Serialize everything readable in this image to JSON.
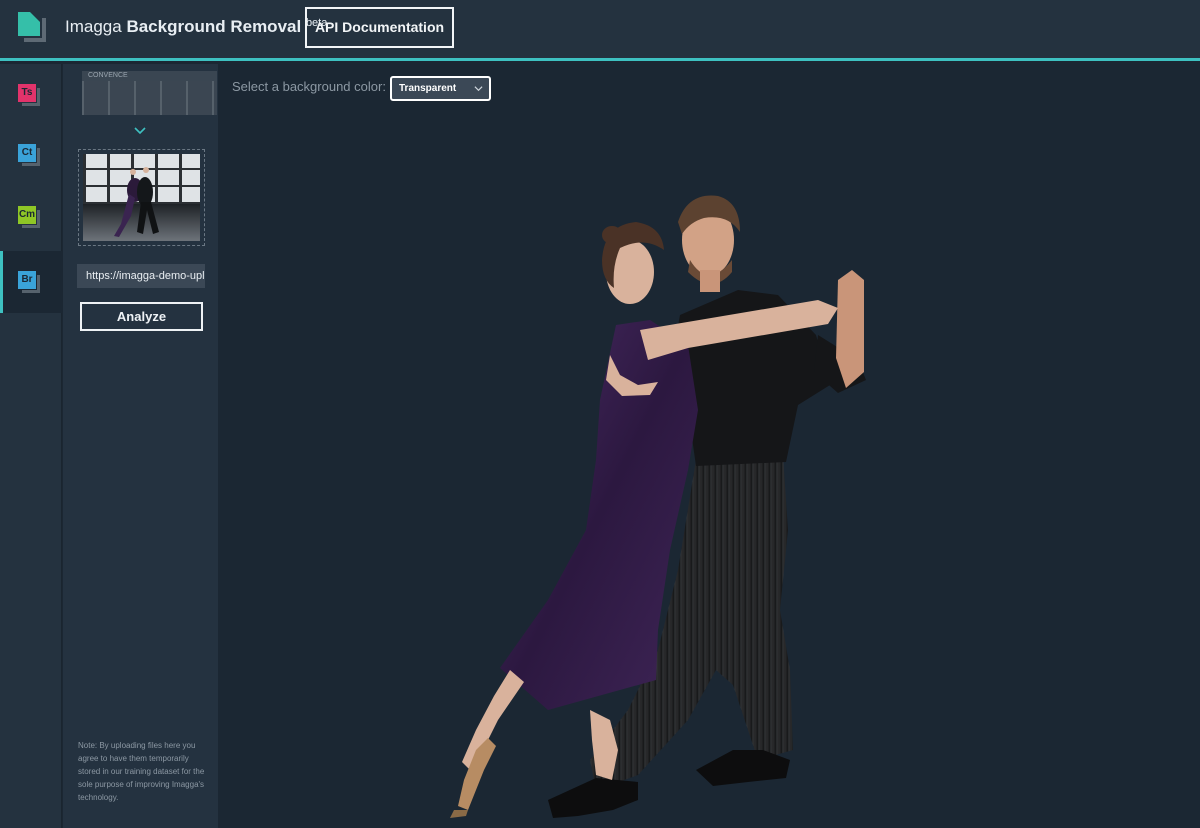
{
  "header": {
    "brand_prefix": "Imagga",
    "brand_product": "Background Removal",
    "brand_suffix": "beta",
    "api_button_label": "API Documentation"
  },
  "rail": {
    "items": [
      {
        "code": "Ts",
        "color": "#e2336b",
        "active": false
      },
      {
        "code": "Ct",
        "color": "#3aa3d9",
        "active": false
      },
      {
        "code": "Cm",
        "color": "#8fc726",
        "active": false
      },
      {
        "code": "Br",
        "color": "#3aa3d9",
        "active": true
      }
    ]
  },
  "panel": {
    "prev_thumb_text": "CONVENCE",
    "url_value": "https://imagga-demo-uplo",
    "analyze_label": "Analyze",
    "note": "Note: By uploading files here you agree to have them temporarily stored in our training dataset for the sole purpose of improving Imagga's technology."
  },
  "main": {
    "bg_label": "Select a background color:",
    "bg_selected": "Transparent"
  },
  "colors": {
    "accent": "#3ec1c1",
    "header_bg": "#24323f",
    "main_bg": "#1b2733"
  }
}
